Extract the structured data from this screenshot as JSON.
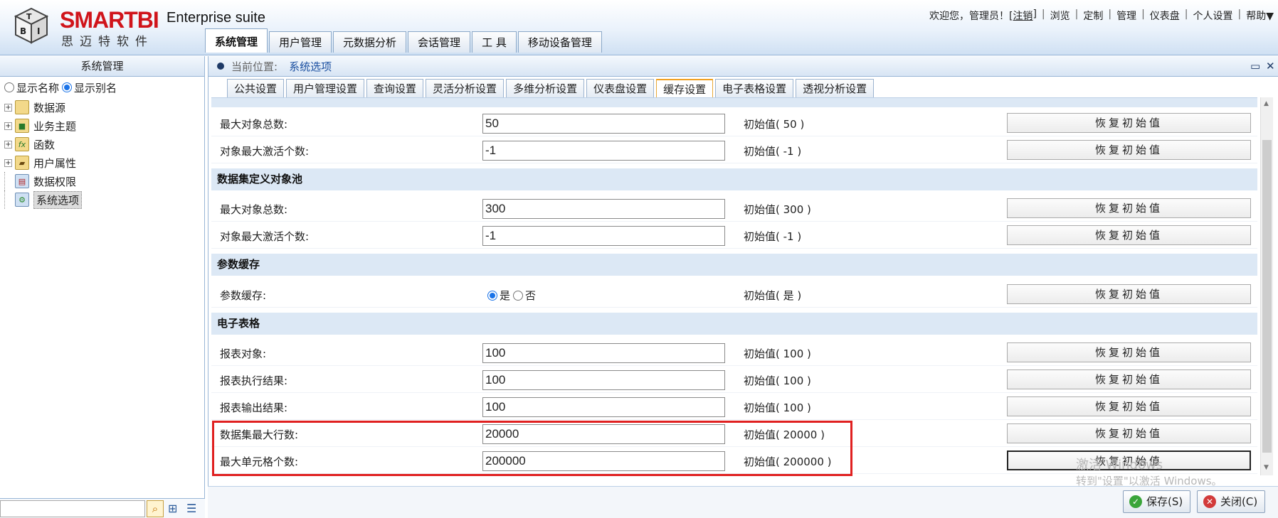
{
  "header": {
    "brand": "SMARTBI",
    "brand_cn": "思迈特软件",
    "suite": "Enterprise suite",
    "welcome": "欢迎您，管理员！[",
    "logout": "注销",
    "welcome_end": "]",
    "links": [
      "浏览",
      "定制",
      "管理",
      "仪表盘",
      "个人设置",
      "帮助▼"
    ]
  },
  "main_tabs": [
    "系统管理",
    "用户管理",
    "元数据分析",
    "会话管理",
    "工 具",
    "移动设备管理"
  ],
  "left": {
    "title": "系统管理",
    "radio_name": "显示名称",
    "radio_alias": "显示别名",
    "tree": [
      {
        "label": "数据源",
        "expandable": true
      },
      {
        "label": "业务主题",
        "expandable": true
      },
      {
        "label": "函数",
        "expandable": true
      },
      {
        "label": "用户属性",
        "expandable": true
      },
      {
        "label": "数据权限",
        "expandable": false
      },
      {
        "label": "系统选项",
        "expandable": false,
        "selected": true
      }
    ]
  },
  "crumb": {
    "label": "当前位置:",
    "current": "系统选项"
  },
  "sub_tabs": [
    "公共设置",
    "用户管理设置",
    "查询设置",
    "灵活分析设置",
    "多维分析设置",
    "仪表盘设置",
    "缓存设置",
    "电子表格设置",
    "透视分析设置"
  ],
  "reset_label": "恢复初始值",
  "sections": {
    "s1_rows": [
      {
        "label": "最大对象总数:",
        "value": "50",
        "init": "初始值( 50 )"
      },
      {
        "label": "对象最大激活个数:",
        "value": "-1",
        "init": "初始值( -1 )"
      }
    ],
    "s2_title": "数据集定义对象池",
    "s2_rows": [
      {
        "label": "最大对象总数:",
        "value": "300",
        "init": "初始值( 300 )"
      },
      {
        "label": "对象最大激活个数:",
        "value": "-1",
        "init": "初始值( -1 )"
      }
    ],
    "s3_title": "参数缓存",
    "s3_row": {
      "label": "参数缓存:",
      "yes": "是",
      "no": "否",
      "init": "初始值( 是 )"
    },
    "s4_title": "电子表格",
    "s4_rows": [
      {
        "label": "报表对象:",
        "value": "100",
        "init": "初始值( 100 )"
      },
      {
        "label": "报表执行结果:",
        "value": "100",
        "init": "初始值( 100 )"
      },
      {
        "label": "报表输出结果:",
        "value": "100",
        "init": "初始值( 100 )"
      },
      {
        "label": "数据集最大行数:",
        "value": "20000",
        "init": "初始值( 20000 )"
      },
      {
        "label": "最大单元格个数:",
        "value": "200000",
        "init": "初始值( 200000 )"
      }
    ]
  },
  "actions": {
    "save": "保存(S)",
    "close": "关闭(C)"
  },
  "watermark": {
    "line1": "激活 Windows",
    "line2": "转到\"设置\"以激活 Windows。"
  }
}
